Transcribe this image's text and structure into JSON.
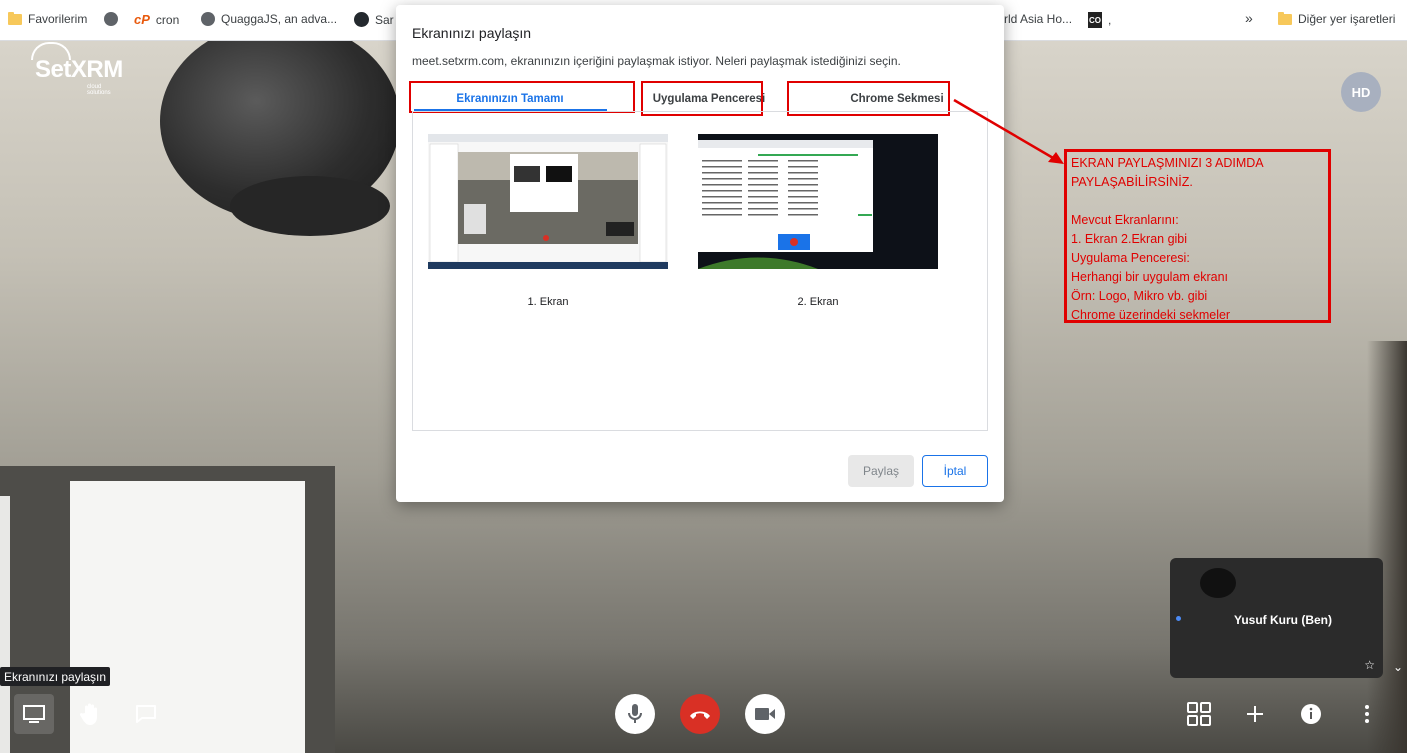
{
  "bookmarks": {
    "items": [
      {
        "label": "Favorilerim",
        "icon": "folder-icon"
      },
      {
        "label": "",
        "icon": "globe-icon"
      },
      {
        "label": "cron",
        "icon": "cpanel-icon"
      },
      {
        "label": "QuaggaJS, an adva...",
        "icon": "globe-icon"
      },
      {
        "label": "Sar",
        "icon": "github-icon"
      },
      {
        "label": "rld Asia Ho...",
        "icon": "bookmark-icon"
      },
      {
        "label": ",",
        "icon": "co-icon"
      }
    ],
    "more": "»",
    "other": "Diğer yer işaretleri"
  },
  "logo": {
    "name": "SetXRM",
    "tagline": "cloud solutions"
  },
  "avatar": {
    "initials": "HD"
  },
  "dialog": {
    "title": "Ekranınızı paylaşın",
    "description": "meet.setxrm.com, ekranınızın içeriğini paylaşmak istiyor. Neleri paylaşmak istediğinizi seçin.",
    "tabs": [
      {
        "label": "Ekranınızın Tamamı",
        "active": true
      },
      {
        "label": "Uygulama Penceresi",
        "active": false
      },
      {
        "label": "Chrome Sekmesi",
        "active": false
      }
    ],
    "screens": [
      {
        "label": "1. Ekran"
      },
      {
        "label": "2. Ekran"
      }
    ],
    "share_button": "Paylaş",
    "cancel_button": "İptal"
  },
  "annotation": {
    "lines": [
      "EKRAN PAYLAŞMINIZI 3 ADIMDA",
      "PAYLAŞABİLİRSİNİZ.",
      "",
      "Mevcut Ekranlarını:",
      "1. Ekran 2.Ekran gibi",
      "Uygulama Penceresi:",
      "Herhangi bir uygulam ekranı",
      "Örn: Logo, Mikro vb. gibi",
      "Chrome üzerindeki sekmeler"
    ],
    "color": "#e00000"
  },
  "self_view": {
    "name": "Yusuf Kuru (Ben)"
  },
  "tooltip": "Ekranınızı paylaşın",
  "colors": {
    "accent": "#1a73e8",
    "hangup": "#d93025",
    "annotation": "#e00000"
  }
}
